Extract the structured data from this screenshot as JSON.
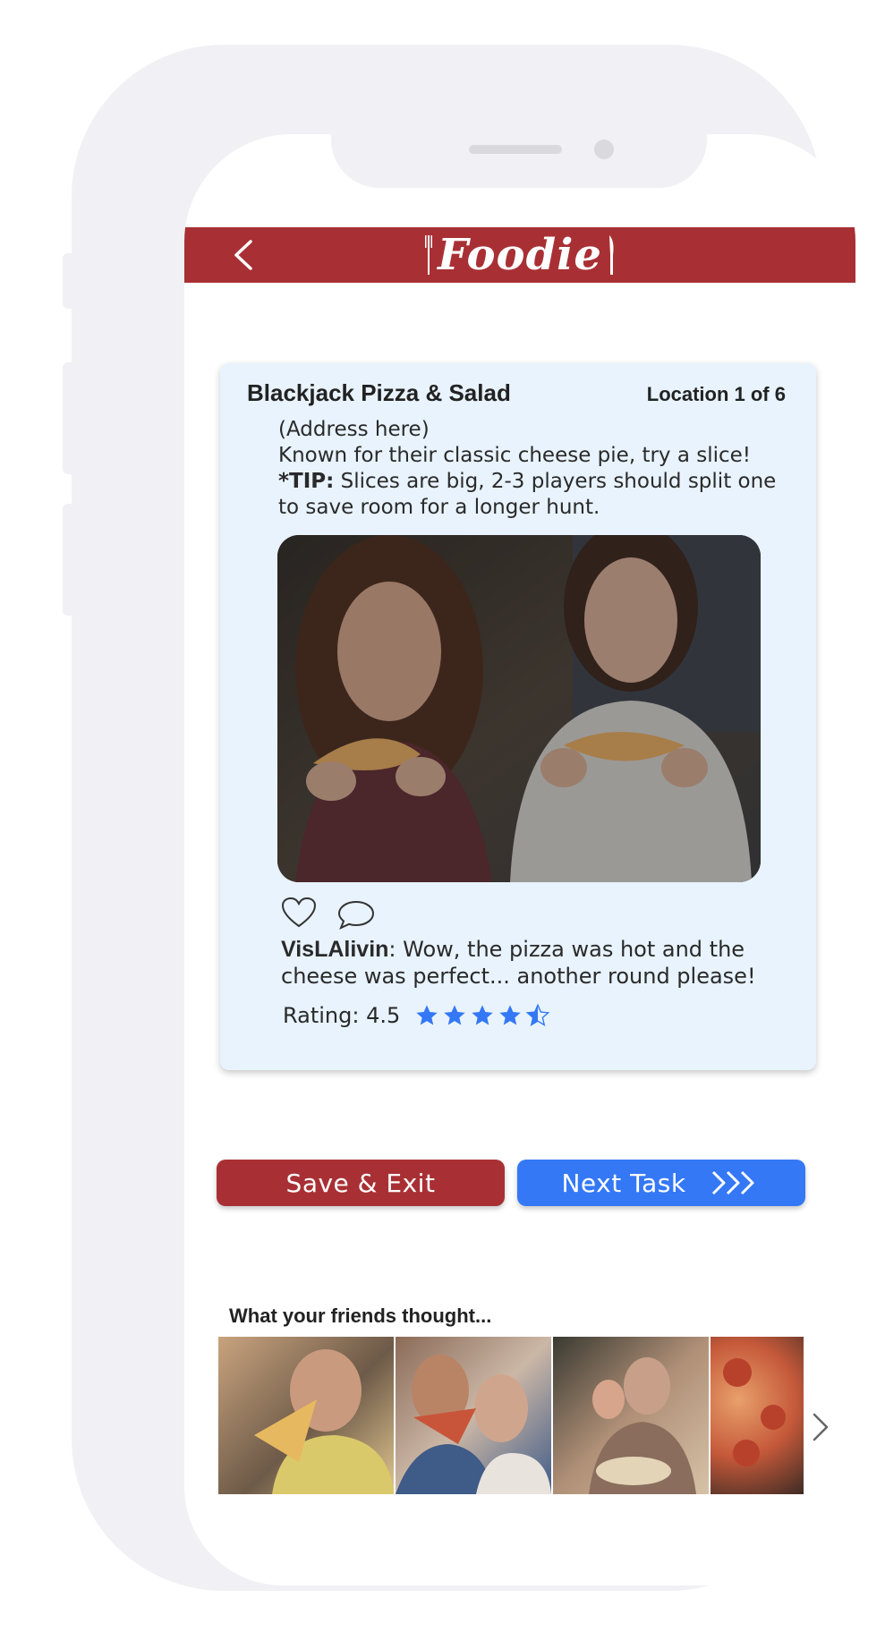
{
  "app": {
    "name": "Foodie",
    "header_color": "#a83034",
    "back_icon": "chevron-left-icon"
  },
  "card": {
    "title": "Blackjack Pizza & Salad",
    "location": "Location 1 of 6",
    "address": "(Address here)",
    "description": "Known for their classic cheese pie, try a slice!",
    "tip_label": "*TIP:",
    "tip_line1": " Slices are big, 2-3 players should split one",
    "tip_line2": "to save room for a longer hunt.",
    "background": "#e8f3fd"
  },
  "post": {
    "like_icon": "heart-icon",
    "comment_icon": "comment-icon",
    "user": "VisLAlivin",
    "comment_line1": ": Wow, the pizza was hot and the",
    "comment_line2": "cheese was perfect... another round please!",
    "rating_text": "Rating: 4.5",
    "rating_value": 4.5,
    "rating_max": 5,
    "star_color": "#3478f6"
  },
  "actions": {
    "save_label": "Save & Exit",
    "save_color": "#a83034",
    "next_label": "Next Task",
    "next_color": "#3478f6",
    "next_icon": "triple-chevron-right-icon"
  },
  "friends": {
    "label": "What your friends thought...",
    "more_icon": "chevron-right-icon"
  }
}
